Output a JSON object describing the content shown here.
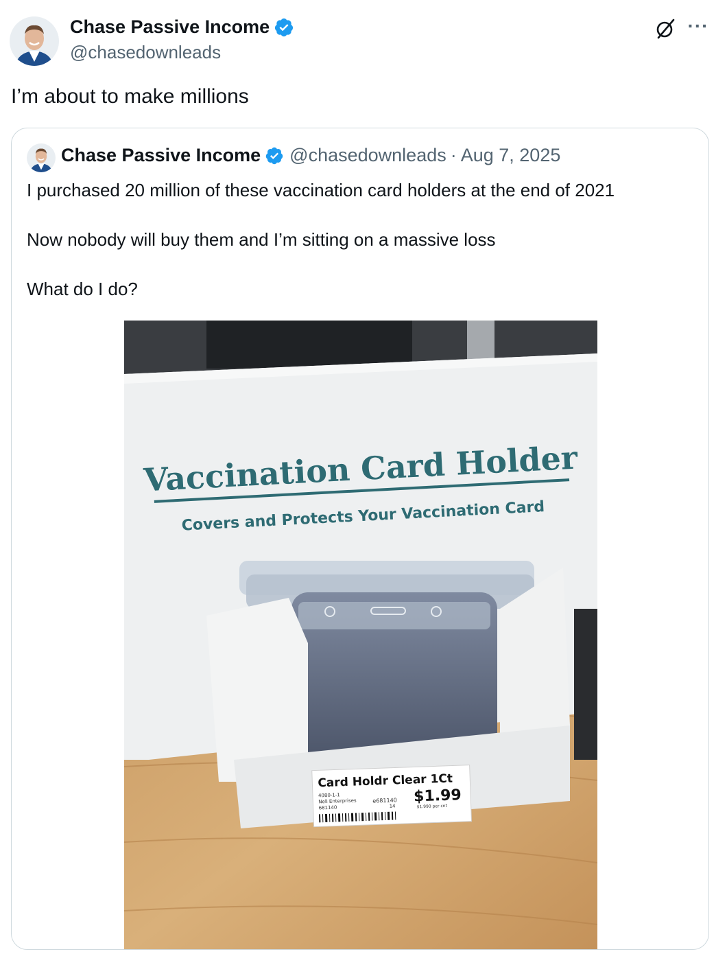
{
  "tweet": {
    "author_name": "Chase Passive Income",
    "author_handle": "@chasedownleads",
    "text": "I’m about to make millions",
    "more_label": "···"
  },
  "quoted_tweet": {
    "author_name": "Chase Passive Income",
    "author_handle": "@chasedownleads",
    "separator": "·",
    "date": "Aug 7, 2025",
    "paragraphs": [
      "I purchased 20 million of these vaccination card holders at the end of 2021",
      "Now nobody will buy them and I’m sitting on a massive loss",
      "What do I do?"
    ],
    "photo": {
      "box_title": "Vaccination Card Holder",
      "box_subtitle": "Covers and Protects Your Vaccination Card",
      "price_tag_name": "Card Holdr Clear 1Ct",
      "price": "$1.99",
      "tag_code_1": "4080-1-1",
      "tag_code_2": "Nell Enterprises",
      "tag_code_3": "681140",
      "tag_code_4": "e681140",
      "tag_code_5": "14",
      "tag_unit_price": "$1.990 per cnt"
    }
  },
  "colors": {
    "accent_blue": "#1d9bf0",
    "secondary_text": "#536471",
    "border": "#cfd9de",
    "box_teal": "#2e6b73"
  }
}
